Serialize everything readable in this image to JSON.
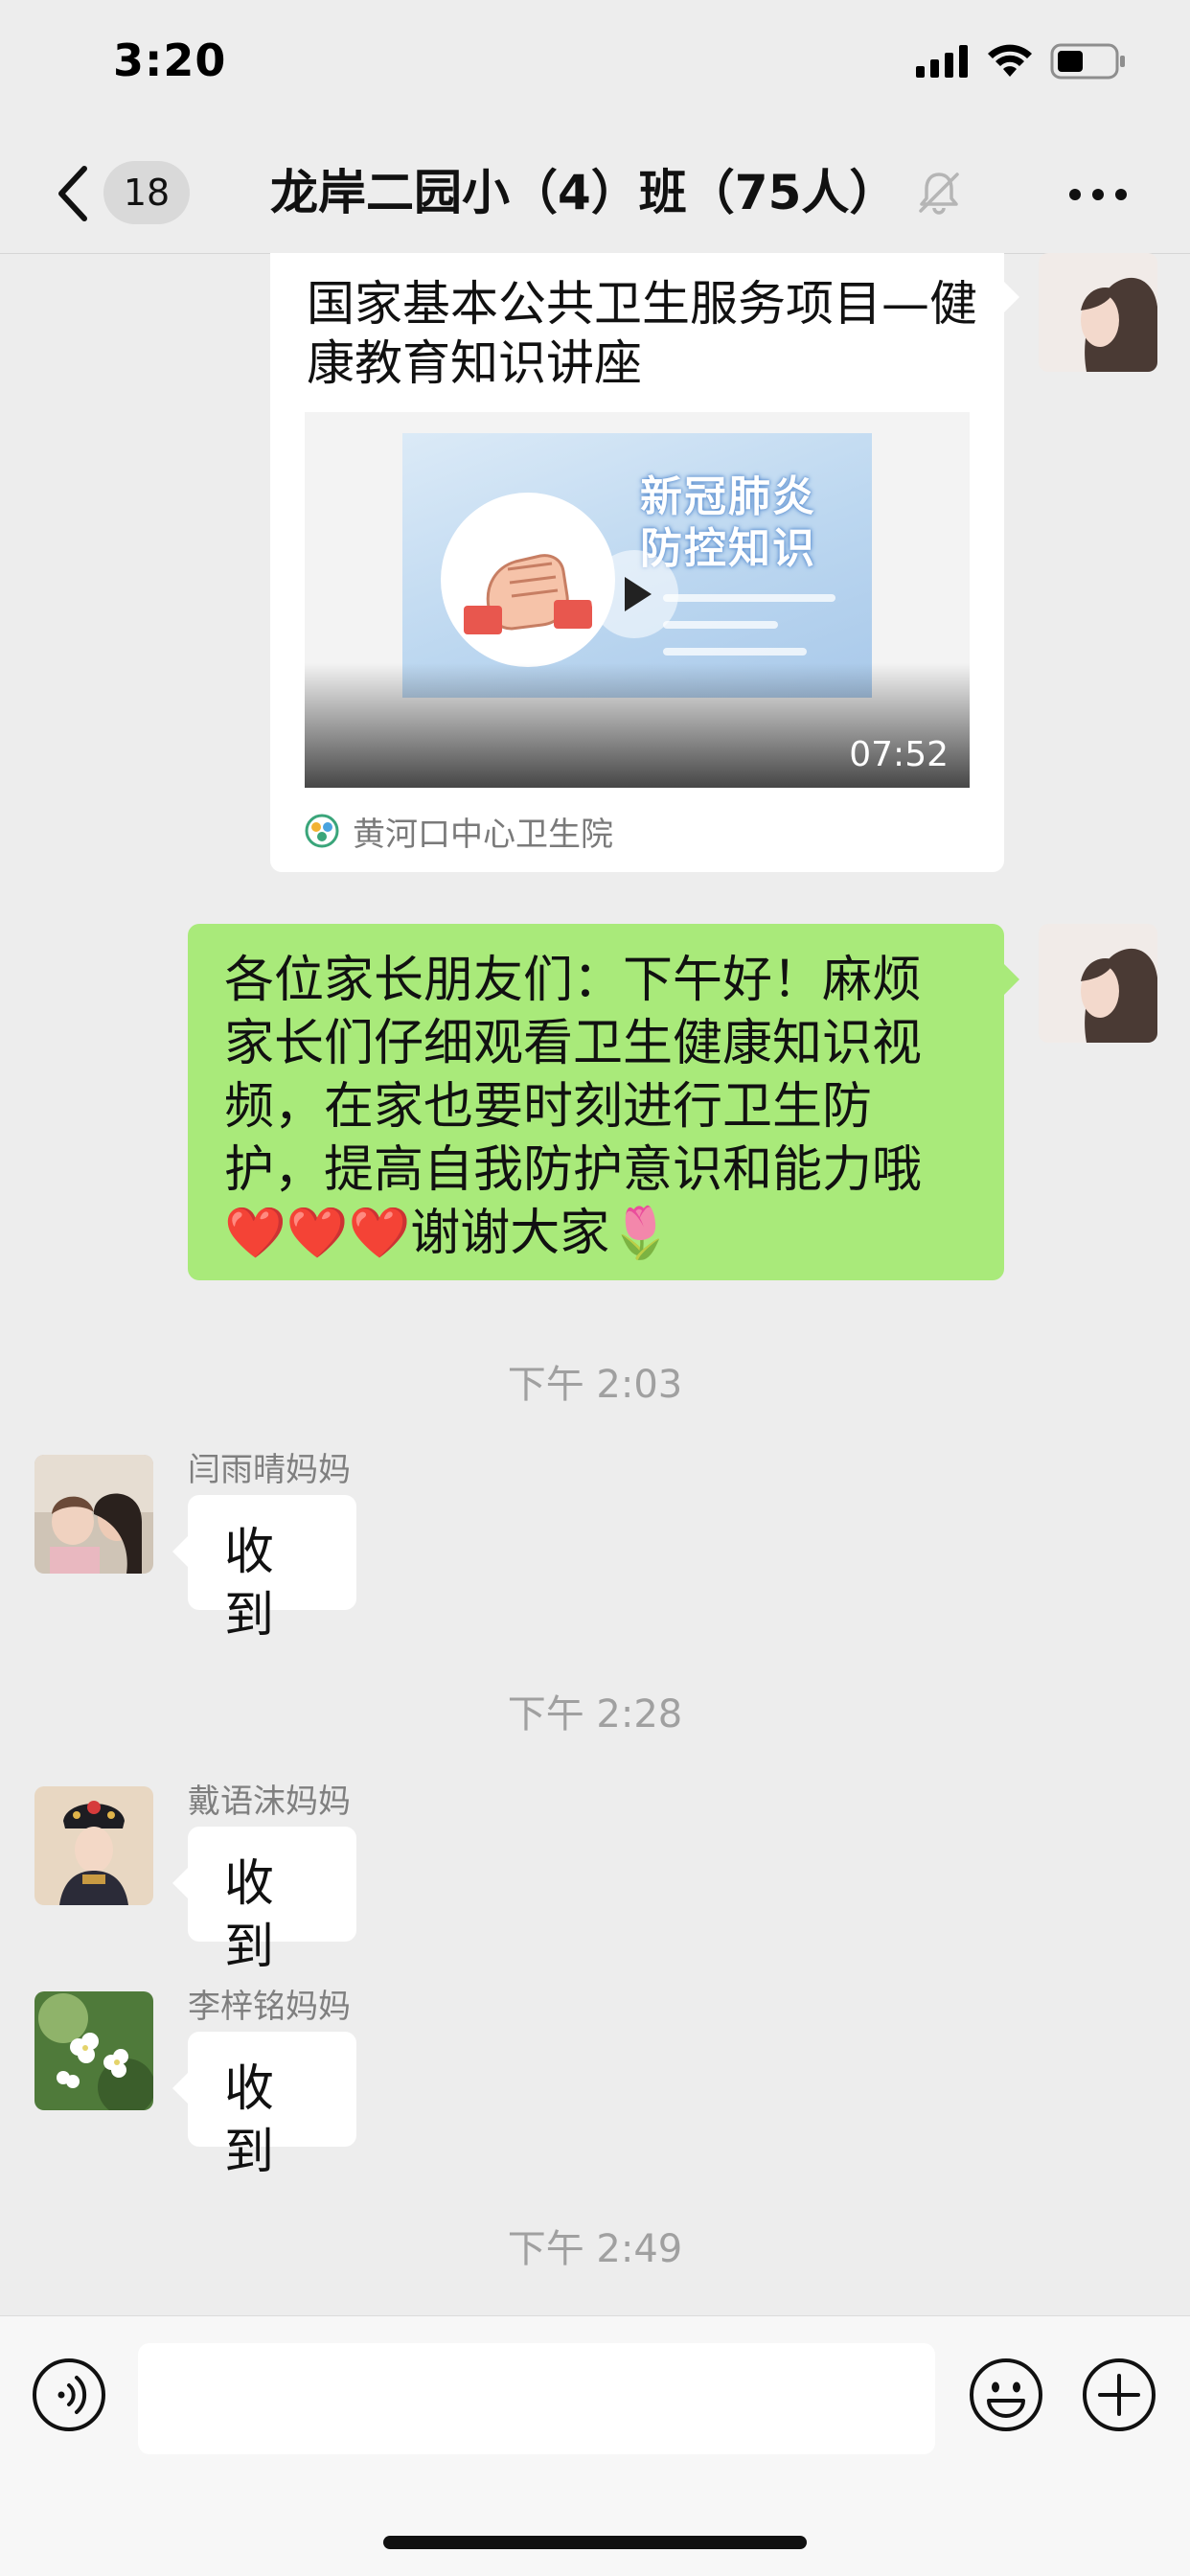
{
  "status_bar": {
    "time": "3:20"
  },
  "nav": {
    "unread_count": "18",
    "title": "龙岸二园小（4）班（75人）"
  },
  "messages": {
    "video_card": {
      "title": "国家基本公共卫生服务项目—健康教育知识讲座",
      "thumbnail_text": "新冠肺炎\n防控知识",
      "duration": "07:52",
      "source": "黄河口中心卫生院"
    },
    "announcement": {
      "text": "各位家长朋友们：下午好！麻烦家长们仔细观看卫生健康知识视频，在家也要时刻进行卫生防护，提高自我防护意识和能力哦❤️❤️❤️谢谢大家🌷"
    },
    "time_1": "下午 2:03",
    "reply_1": {
      "sender": "闫雨晴妈妈",
      "text": "收到"
    },
    "time_2": "下午 2:28",
    "reply_2": {
      "sender": "戴语沫妈妈",
      "text": "收到"
    },
    "reply_3": {
      "sender": "李梓铭妈妈",
      "text": "收到"
    },
    "time_3": "下午 2:49"
  },
  "input": {
    "value": "",
    "placeholder": ""
  },
  "icons": {
    "back": "chevron-left-icon",
    "mute": "bell-slash-icon",
    "more": "more-dots-icon",
    "voice": "voice-icon",
    "emoji": "emoji-icon",
    "plus": "plus-icon",
    "play": "play-icon",
    "signal": "signal-icon",
    "wifi": "wifi-icon",
    "battery": "battery-icon"
  },
  "colors": {
    "background": "#ededed",
    "bubble_self": "#a9ea7a",
    "bubble_other": "#ffffff",
    "sender_name": "#7f7f7f",
    "timestamp": "#a0a0a0"
  }
}
